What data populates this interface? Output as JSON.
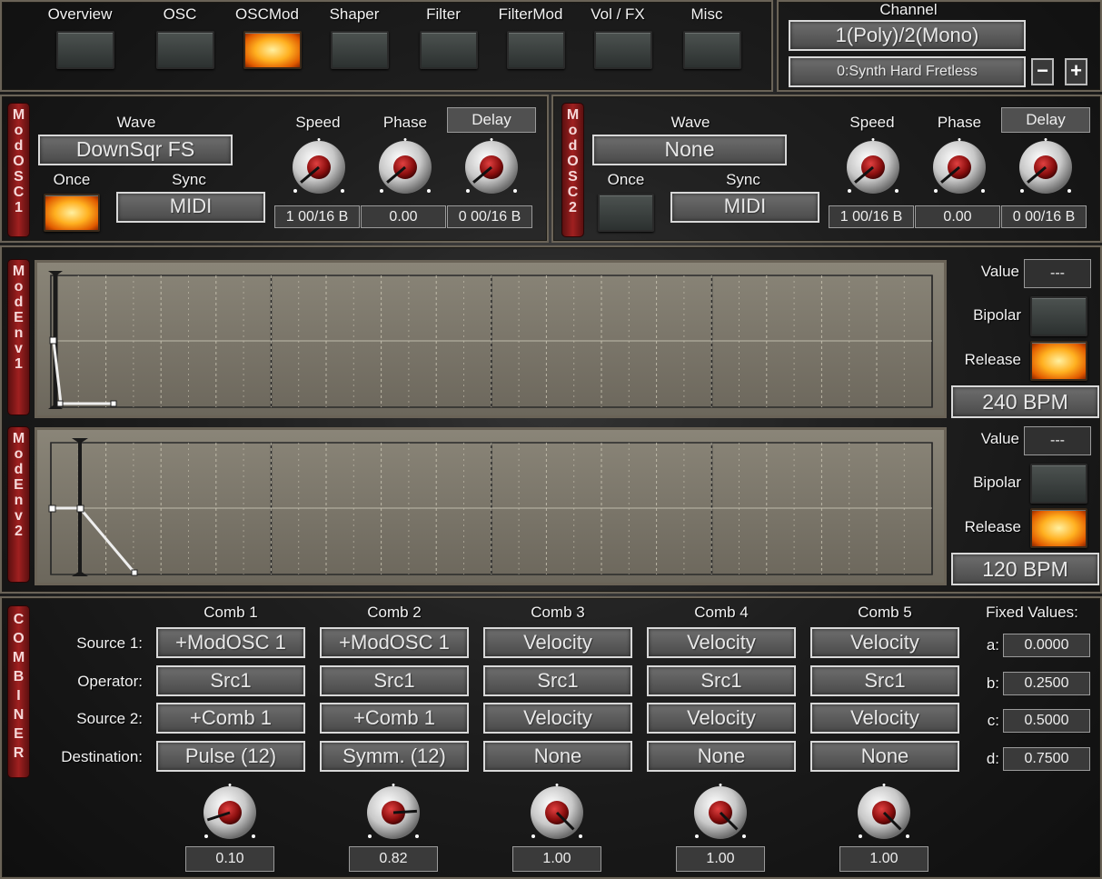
{
  "nav": {
    "tabs": [
      {
        "label": "Overview",
        "active": false
      },
      {
        "label": "OSC",
        "active": false
      },
      {
        "label": "OSCMod",
        "active": true
      },
      {
        "label": "Shaper",
        "active": false
      },
      {
        "label": "Filter",
        "active": false
      },
      {
        "label": "FilterMod",
        "active": false
      },
      {
        "label": "Vol / FX",
        "active": false
      },
      {
        "label": "Misc",
        "active": false
      }
    ]
  },
  "channel": {
    "label": "Channel",
    "value": "1(Poly)/2(Mono)",
    "preset": "0:Synth Hard Fretless",
    "minus": "−",
    "plus": "+"
  },
  "modosc": [
    {
      "tab": [
        "M",
        "o",
        "d",
        "O",
        "S",
        "C",
        "1"
      ],
      "wave_label": "Wave",
      "wave_value": "DownSqr FS",
      "once_label": "Once",
      "once_on": true,
      "sync_label": "Sync",
      "sync_value": "MIDI",
      "speed_label": "Speed",
      "phase_label": "Phase",
      "delay_label": "Delay",
      "speed_value": "1 00/16 B",
      "phase_value": "0.00",
      "delay_value": "0 00/16 B",
      "knob_angles": [
        -130,
        -130,
        -130
      ]
    },
    {
      "tab": [
        "M",
        "o",
        "d",
        "O",
        "S",
        "C",
        "2"
      ],
      "wave_label": "Wave",
      "wave_value": "None",
      "once_label": "Once",
      "once_on": false,
      "sync_label": "Sync",
      "sync_value": "MIDI",
      "speed_label": "Speed",
      "phase_label": "Phase",
      "delay_label": "Delay",
      "speed_value": "1 00/16 B",
      "phase_value": "0.00",
      "delay_value": "0 00/16 B",
      "knob_angles": [
        -130,
        -130,
        -130
      ]
    }
  ],
  "modenv": [
    {
      "tab": [
        "M",
        "o",
        "d",
        "E",
        "n",
        "v",
        "1"
      ],
      "value_label": "Value",
      "value": "---",
      "bipolar_label": "Bipolar",
      "bipolar_on": false,
      "release_label": "Release",
      "release_on": true,
      "bpm": "240 BPM"
    },
    {
      "tab": [
        "M",
        "o",
        "d",
        "E",
        "n",
        "v",
        "2"
      ],
      "value_label": "Value",
      "value": "---",
      "bipolar_label": "Bipolar",
      "bipolar_on": false,
      "release_label": "Release",
      "release_on": true,
      "bpm": "120 BPM"
    }
  ],
  "combiner": {
    "tab": [
      "C",
      "O",
      "M",
      "B",
      "I",
      "N",
      "E",
      "R"
    ],
    "row_labels": [
      "Source 1:",
      "Operator:",
      "Source 2:",
      "Destination:"
    ],
    "combs": [
      {
        "label": "Comb 1",
        "source1": "+ModOSC 1",
        "operator": "Src1",
        "source2": "+Comb 1",
        "destination": "Pulse (12)",
        "value": "0.10",
        "knob_level": 0.1
      },
      {
        "label": "Comb 2",
        "source1": "+ModOSC 1",
        "operator": "Src1",
        "source2": "+Comb 1",
        "destination": "Symm. (12)",
        "value": "0.82",
        "knob_level": 0.82
      },
      {
        "label": "Comb 3",
        "source1": "Velocity",
        "operator": "Src1",
        "source2": "Velocity",
        "destination": "None",
        "value": "1.00",
        "knob_level": 1.0
      },
      {
        "label": "Comb 4",
        "source1": "Velocity",
        "operator": "Src1",
        "source2": "Velocity",
        "destination": "None",
        "value": "1.00",
        "knob_level": 1.0
      },
      {
        "label": "Comb 5",
        "source1": "Velocity",
        "operator": "Src1",
        "source2": "Velocity",
        "destination": "None",
        "value": "1.00",
        "knob_level": 1.0
      }
    ],
    "fixed_label": "Fixed Values:",
    "fixed": [
      {
        "key": "a:",
        "value": "0.0000"
      },
      {
        "key": "b:",
        "value": "0.2500"
      },
      {
        "key": "c:",
        "value": "0.5000"
      },
      {
        "key": "d:",
        "value": "0.7500"
      }
    ]
  },
  "colors": {
    "accent_on": "#ffb020",
    "tab_red": "#a02020",
    "border": "#6a6357"
  }
}
